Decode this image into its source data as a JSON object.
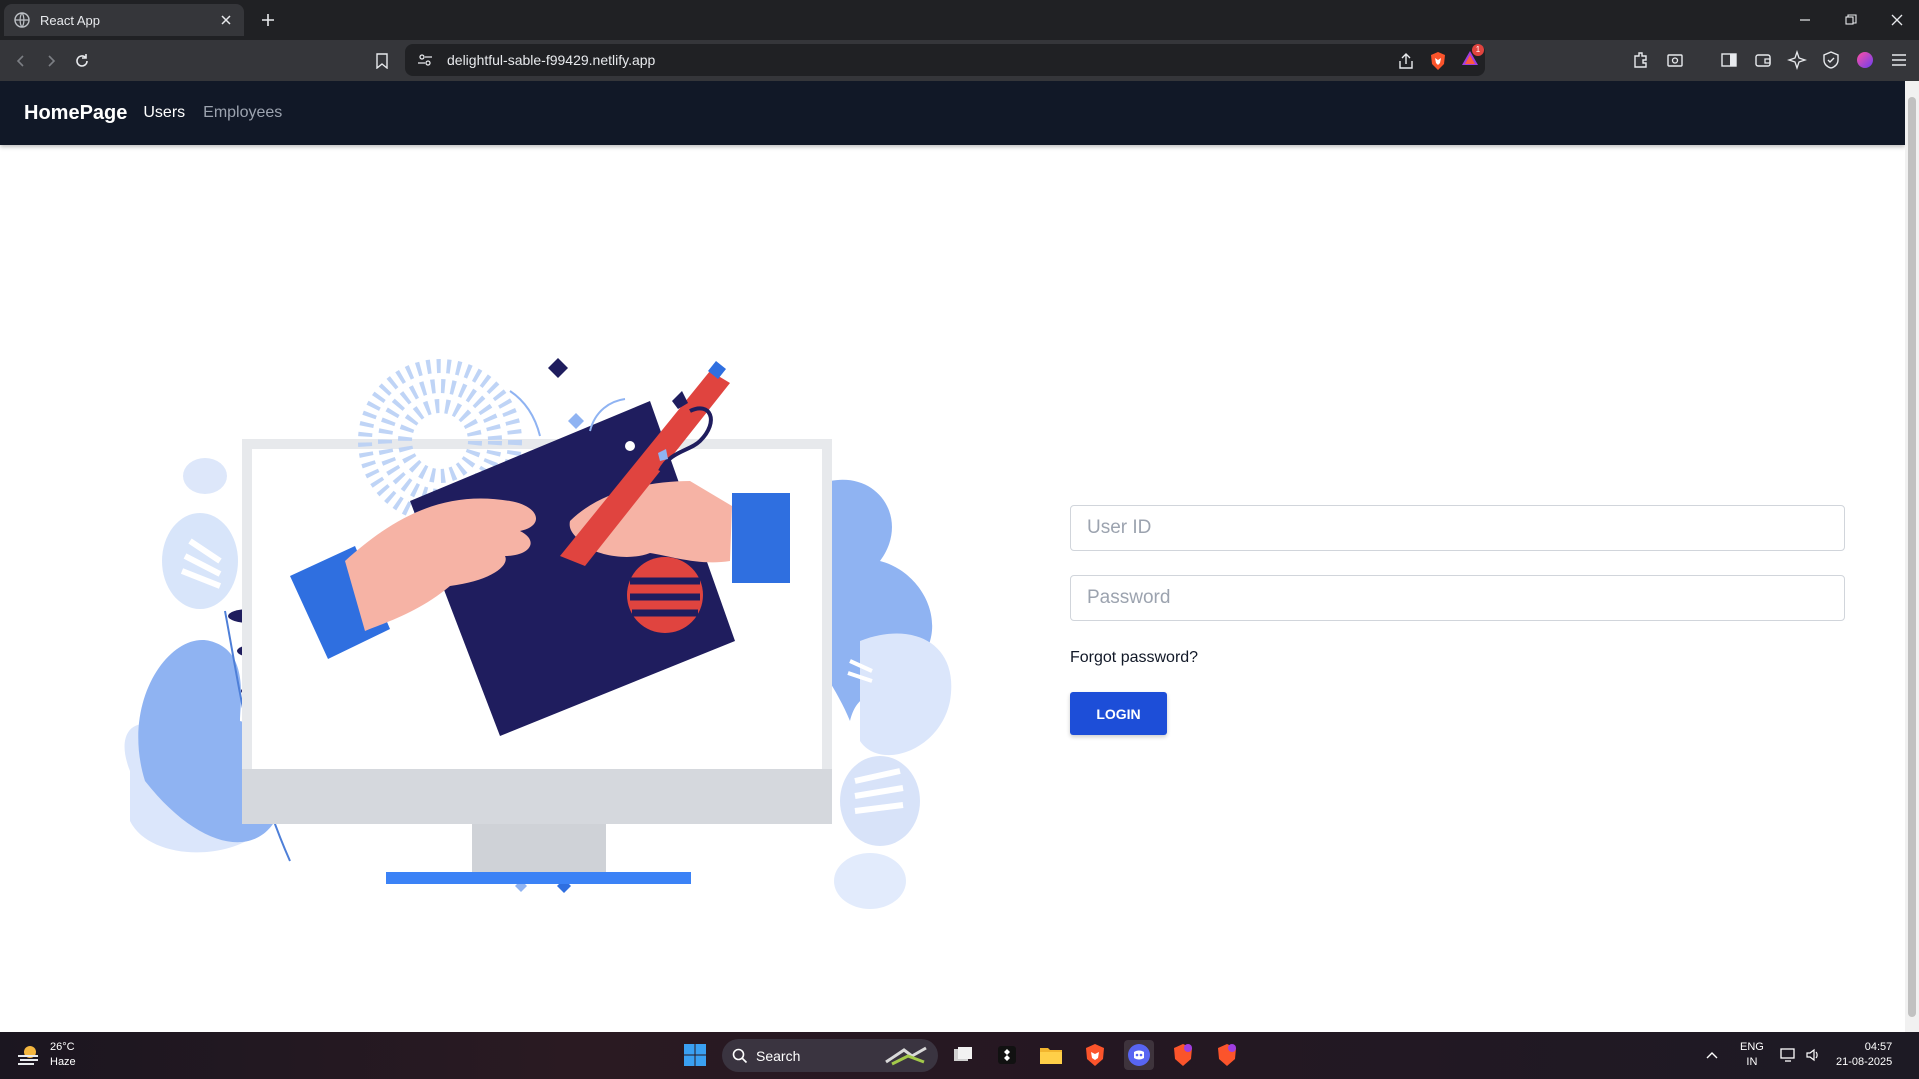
{
  "browser": {
    "tab_title": "React App",
    "url": "delightful-sable-f99429.netlify.app",
    "notification_count": "1"
  },
  "page": {
    "navbar": {
      "brand": "HomePage",
      "links": [
        "Users",
        "Employees"
      ]
    },
    "login": {
      "userid_placeholder": "User ID",
      "password_placeholder": "Password",
      "forgot_link": "Forgot password?",
      "login_button": "LOGIN"
    }
  },
  "taskbar": {
    "weather_temp": "26°C",
    "weather_desc": "Haze",
    "search_placeholder": "Search",
    "lang_line1": "ENG",
    "lang_line2": "IN",
    "time": "04:57",
    "date": "21-08-2025"
  },
  "colors": {
    "navbar_bg": "#111827",
    "button_bg": "#1d4ed8",
    "illustration_navy": "#1f1d5e",
    "illustration_blue": "#2f6fe0",
    "illustration_red": "#e0443f",
    "illustration_skin": "#f6b3a5"
  },
  "icons": [
    "globe-icon",
    "close-icon",
    "plus-icon",
    "back-icon",
    "forward-icon",
    "reload-icon",
    "bookmark-icon",
    "site-settings-icon",
    "share-icon",
    "brave-shield-icon",
    "brave-rewards-icon",
    "extensions-icon",
    "sidebar-icon",
    "wallet-icon",
    "leo-ai-icon",
    "vpn-icon",
    "menu-icon",
    "windows-start-icon",
    "search-icon",
    "file-explorer-icon",
    "discord-icon",
    "brave-icon"
  ]
}
